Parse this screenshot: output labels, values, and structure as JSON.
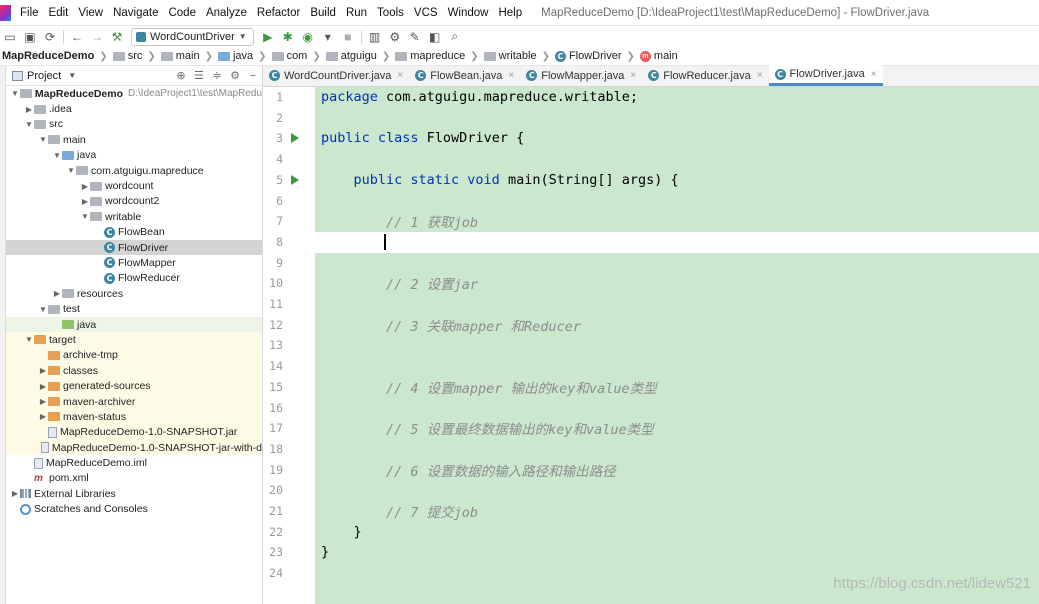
{
  "menu": [
    "File",
    "Edit",
    "View",
    "Navigate",
    "Code",
    "Analyze",
    "Refactor",
    "Build",
    "Run",
    "Tools",
    "VCS",
    "Window",
    "Help"
  ],
  "window_title": "MapReduceDemo [D:\\IdeaProject1\\test\\MapReduceDemo] - FlowDriver.java",
  "toolbar": {
    "run_config": "WordCountDriver"
  },
  "breadcrumb": [
    "MapReduceDemo",
    "src",
    "main",
    "java",
    "com",
    "atguigu",
    "mapreduce",
    "writable",
    "FlowDriver",
    "main"
  ],
  "project_panel": {
    "title": "Project"
  },
  "tree": [
    {
      "label": "MapReduceDemo",
      "path": "D:\\IdeaProject1\\test\\MapRedu",
      "icon": "folder",
      "level": 0,
      "arrow": "down",
      "bold": true
    },
    {
      "label": ".idea",
      "icon": "folder",
      "level": 1,
      "arrow": "right"
    },
    {
      "label": "src",
      "icon": "folder",
      "level": 1,
      "arrow": "down"
    },
    {
      "label": "main",
      "icon": "folder",
      "level": 2,
      "arrow": "down"
    },
    {
      "label": "java",
      "icon": "folder-blue",
      "level": 3,
      "arrow": "down"
    },
    {
      "label": "com.atguigu.mapreduce",
      "icon": "package",
      "level": 4,
      "arrow": "down"
    },
    {
      "label": "wordcount",
      "icon": "package",
      "level": 5,
      "arrow": "right"
    },
    {
      "label": "wordcount2",
      "icon": "package",
      "level": 5,
      "arrow": "right"
    },
    {
      "label": "writable",
      "icon": "package",
      "level": 5,
      "arrow": "down"
    },
    {
      "label": "FlowBean",
      "icon": "class",
      "level": 6,
      "arrow": ""
    },
    {
      "label": "FlowDriver",
      "icon": "class",
      "level": 6,
      "arrow": "",
      "selected": true
    },
    {
      "label": "FlowMapper",
      "icon": "class",
      "level": 6,
      "arrow": ""
    },
    {
      "label": "FlowReducer",
      "icon": "class",
      "level": 6,
      "arrow": ""
    },
    {
      "label": "resources",
      "icon": "folder",
      "level": 3,
      "arrow": "right"
    },
    {
      "label": "test",
      "icon": "folder",
      "level": 2,
      "arrow": "down"
    },
    {
      "label": "java",
      "icon": "folder-green",
      "level": 3,
      "arrow": "",
      "bg": "test"
    },
    {
      "label": "target",
      "icon": "folder-orange",
      "level": 1,
      "arrow": "down",
      "bg": "target"
    },
    {
      "label": "archive-tmp",
      "icon": "folder-orange",
      "level": 2,
      "arrow": "",
      "bg": "target"
    },
    {
      "label": "classes",
      "icon": "folder-orange",
      "level": 2,
      "arrow": "right",
      "bg": "target"
    },
    {
      "label": "generated-sources",
      "icon": "folder-orange",
      "level": 2,
      "arrow": "right",
      "bg": "target"
    },
    {
      "label": "maven-archiver",
      "icon": "folder-orange",
      "level": 2,
      "arrow": "right",
      "bg": "target"
    },
    {
      "label": "maven-status",
      "icon": "folder-orange",
      "level": 2,
      "arrow": "right",
      "bg": "target"
    },
    {
      "label": "MapReduceDemo-1.0-SNAPSHOT.jar",
      "icon": "file",
      "level": 2,
      "arrow": "",
      "bg": "target"
    },
    {
      "label": "MapReduceDemo-1.0-SNAPSHOT-jar-with-d",
      "icon": "file",
      "level": 2,
      "arrow": "",
      "bg": "target"
    },
    {
      "label": "MapReduceDemo.iml",
      "icon": "file",
      "level": 1,
      "arrow": ""
    },
    {
      "label": "pom.xml",
      "icon": "maven",
      "level": 1,
      "arrow": ""
    },
    {
      "label": "External Libraries",
      "icon": "library",
      "level": 0,
      "arrow": "right"
    },
    {
      "label": "Scratches and Consoles",
      "icon": "scratch",
      "level": 0,
      "arrow": ""
    }
  ],
  "tabs": [
    "WordCountDriver.java",
    "FlowBean.java",
    "FlowMapper.java",
    "FlowReducer.java",
    "FlowDriver.java"
  ],
  "active_tab": 4,
  "code": {
    "line_numbers": [
      "1",
      "2",
      "3",
      "4",
      "5",
      "6",
      "7",
      "8",
      "9",
      "10",
      "11",
      "12",
      "13",
      "14",
      "15",
      "16",
      "17",
      "18",
      "19",
      "20",
      "21",
      "22",
      "23",
      "24"
    ],
    "line1_kw": "package",
    "line1_rest": " com.atguigu.mapreduce.writable;",
    "line3_kw": "public class",
    "line3_rest": " FlowDriver {",
    "line5_kw": "    public static void",
    "line5_rest": " main(String[] args) {",
    "c7": "        // 1 获取job",
    "c10": "        // 2 设置jar",
    "c12": "        // 3 关联mapper 和Reducer",
    "c15": "        // 4 设置mapper 输出的key和value类型",
    "c17": "        // 5 设置最终数据输出的key和value类型",
    "c19": "        // 6 设置数据的输入路径和输出路径",
    "c21": "        // 7 提交job",
    "l22": "    }",
    "l23": "}"
  },
  "watermark": "https://blog.csdn.net/lidew521"
}
